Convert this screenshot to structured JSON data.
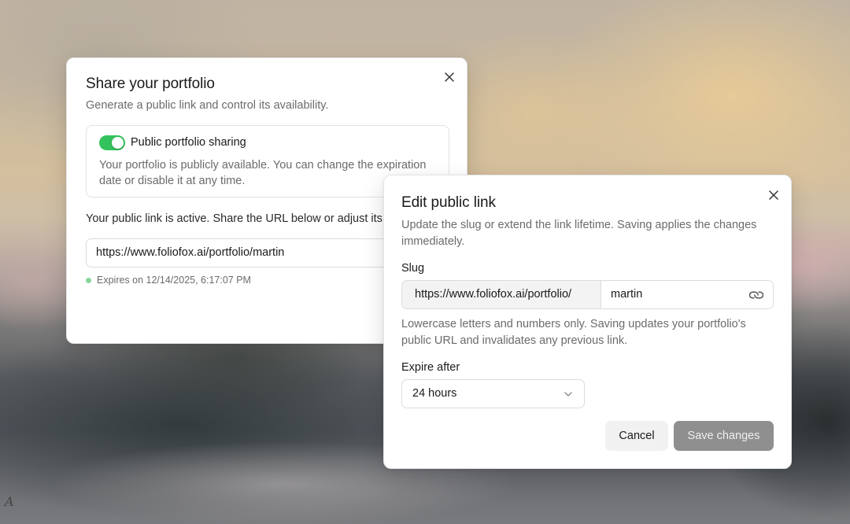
{
  "share_dialog": {
    "title": "Share your portfolio",
    "description": "Generate a public link and control its availability.",
    "sharing_toggle": {
      "label": "Public portfolio sharing",
      "enabled": true,
      "description": "Your portfolio is publicly available. You can change the expiration date or disable it at any time."
    },
    "active_text": "Your public link is active. Share the URL below or adjust its se",
    "url": "https://www.foliofox.ai/portfolio/martin",
    "expires": "Expires on 12/14/2025, 6:17:07 PM"
  },
  "edit_dialog": {
    "title": "Edit public link",
    "description": "Update the slug or extend the link lifetime. Saving applies the changes immediately.",
    "slug_label": "Slug",
    "slug_prefix": "https://www.foliofox.ai/portfolio/",
    "slug_value": "martin",
    "slug_help": "Lowercase letters and numbers only. Saving updates your portfolio's public URL and invalidates any previous link.",
    "expire_label": "Expire after",
    "expire_value": "24 hours",
    "cancel_label": "Cancel",
    "save_label": "Save changes"
  },
  "colors": {
    "toggle_on": "#34c25c",
    "status_dot": "#86d69a",
    "save_disabled": "#8f8f8f"
  },
  "icons": {
    "close": "close-icon",
    "link": "link-icon",
    "chevron": "chevron-down-icon"
  }
}
